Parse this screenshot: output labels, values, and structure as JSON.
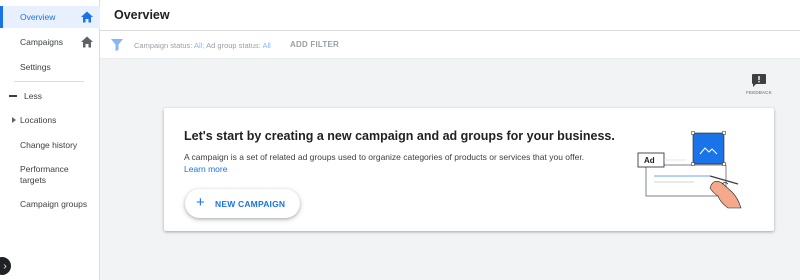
{
  "sidebar": {
    "items": [
      {
        "label": "Overview",
        "icon": "home-icon"
      },
      {
        "label": "Campaigns",
        "icon": "home-icon"
      },
      {
        "label": "Settings"
      },
      {
        "label": "Less"
      },
      {
        "label": "Locations"
      },
      {
        "label": "Change history"
      },
      {
        "label": "Performance targets"
      },
      {
        "label": "Campaign groups"
      }
    ],
    "collapse_icon": "chevron-right-icon"
  },
  "header": {
    "title": "Overview"
  },
  "filter_bar": {
    "icon": "filter-icon",
    "campaign_status_label": "Campaign status:",
    "campaign_status_value": "All;",
    "ad_group_status_label": "Ad group status:",
    "ad_group_status_value": "All",
    "add_filter_label": "ADD FILTER"
  },
  "feedback": {
    "label": "FEEDBACK",
    "icon": "feedback-icon"
  },
  "card": {
    "title": "Let's start by creating a new campaign and ad groups for your business.",
    "description": "A campaign is a set of related ad groups used to organize categories of products or services that you offer.",
    "learn_more": "Learn more",
    "new_campaign_label": "NEW CAMPAIGN",
    "illustration_ad_label": "Ad"
  },
  "colors": {
    "accent": "#1a73e8",
    "active_bg": "#e8f0fe",
    "page_bg": "#f1f3f4",
    "muted": "#9aa0a6"
  }
}
